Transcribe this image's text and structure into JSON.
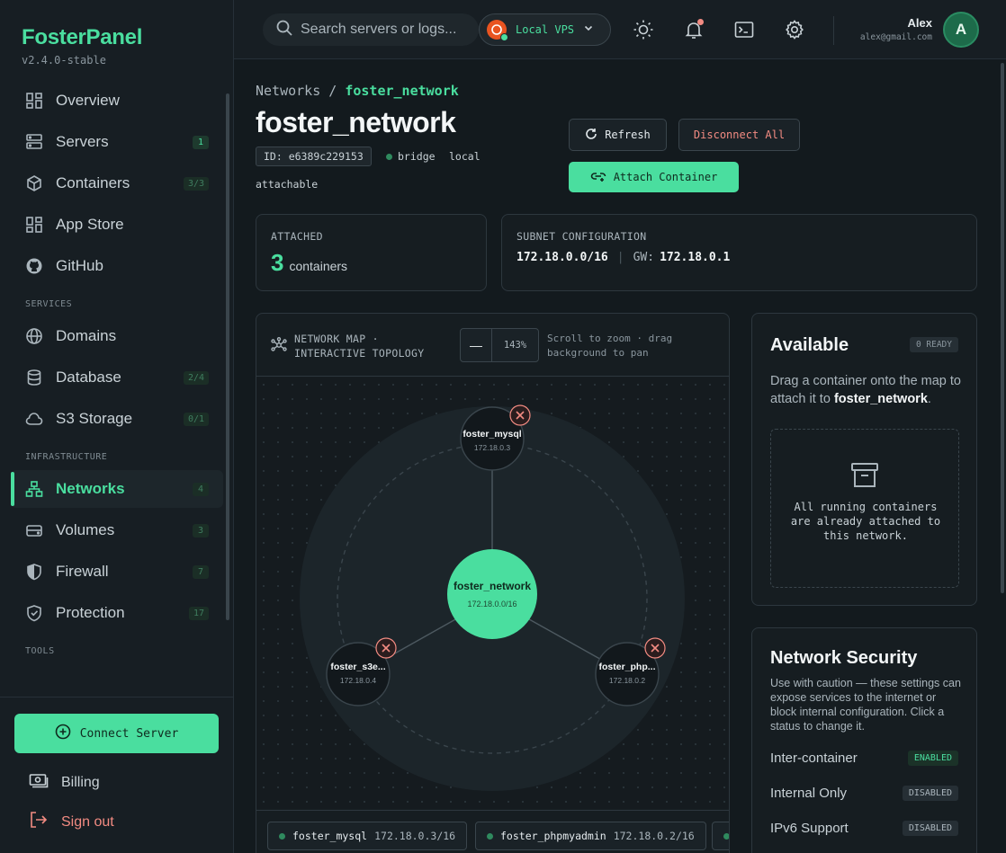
{
  "brand": {
    "name": "FosterPanel",
    "version": "v2.4.0-stable"
  },
  "sidebar": {
    "items": [
      {
        "label": "Overview",
        "badge": "",
        "icon": "grid-icon"
      },
      {
        "label": "Servers",
        "badge": "1",
        "icon": "server-icon"
      },
      {
        "label": "Containers",
        "badge": "3/3",
        "icon": "box-icon"
      },
      {
        "label": "App Store",
        "badge": "",
        "icon": "grid-icon"
      },
      {
        "label": "GitHub",
        "badge": "",
        "icon": "github-icon"
      }
    ],
    "services_title": "SERVICES",
    "services": [
      {
        "label": "Domains",
        "badge": ""
      },
      {
        "label": "Database",
        "badge": "2/4"
      },
      {
        "label": "S3 Storage",
        "badge": "0/1"
      }
    ],
    "infra_title": "INFRASTRUCTURE",
    "infra": [
      {
        "label": "Networks",
        "badge": "4",
        "active": true
      },
      {
        "label": "Volumes",
        "badge": "3"
      },
      {
        "label": "Firewall",
        "badge": "7"
      },
      {
        "label": "Protection",
        "badge": "17"
      }
    ],
    "tools_title": "TOOLS",
    "connect_label": "Connect Server",
    "billing_label": "Billing",
    "signout_label": "Sign out"
  },
  "topbar": {
    "search_placeholder": "Search servers or logs...",
    "server_selector": "Local VPS",
    "user_name": "Alex",
    "user_email": "alex@gmail.com",
    "avatar_initial": "A"
  },
  "page": {
    "breadcrumb_root": "Networks",
    "breadcrumb_sep": "/",
    "breadcrumb_current": "foster_network",
    "title": "foster_network",
    "id_label": "ID: e6389c229153",
    "driver": "bridge",
    "scope": "local",
    "attachable": "attachable",
    "refresh_label": "Refresh",
    "disconnect_label": "Disconnect All",
    "attach_label": "Attach Container"
  },
  "stats": {
    "attached_label": "ATTACHED",
    "attached_count": "3",
    "attached_unit": "containers",
    "subnet_label": "SUBNET CONFIGURATION",
    "subnet": "172.18.0.0/16",
    "subnet_sep": "|",
    "gw_label": "GW:",
    "gw": "172.18.0.1"
  },
  "map": {
    "title_line1": "NETWORK MAP ·",
    "title_line2": "INTERACTIVE TOPOLOGY",
    "zoom_minus": "—",
    "zoom": "143%",
    "hint_line1": "Scroll to zoom · drag",
    "hint_line2": "background to pan",
    "center": {
      "name": "foster_network",
      "subnet": "172.18.0.0/16"
    },
    "nodes": [
      {
        "name": "foster_mysql",
        "ip": "172.18.0.3"
      },
      {
        "name": "foster_s3e...",
        "ip": "172.18.0.4"
      },
      {
        "name": "foster_php...",
        "ip": "172.18.0.2"
      }
    ],
    "chips": [
      {
        "name": "foster_mysql",
        "ip": "172.18.0.3/16"
      },
      {
        "name": "foster_phpmyadmin",
        "ip": "172.18.0.2/16"
      }
    ]
  },
  "available": {
    "title": "Available",
    "badge": "0 READY",
    "desc_pre": "Drag a container onto the map to attach it to ",
    "desc_strong": "foster_network",
    "desc_post": ".",
    "empty_text": "All running containers are already attached to this network."
  },
  "security": {
    "title": "Network Security",
    "desc": "Use with caution — these settings can expose services to the internet or block internal configuration. Click a status to change it.",
    "rows": [
      {
        "label": "Inter-container",
        "status": "ENABLED"
      },
      {
        "label": "Internal Only",
        "status": "DISABLED"
      },
      {
        "label": "IPv6 Support",
        "status": "DISABLED"
      }
    ]
  },
  "colors": {
    "accent": "#4ade9f",
    "danger": "#f28b82",
    "bg": "#131a1e"
  }
}
